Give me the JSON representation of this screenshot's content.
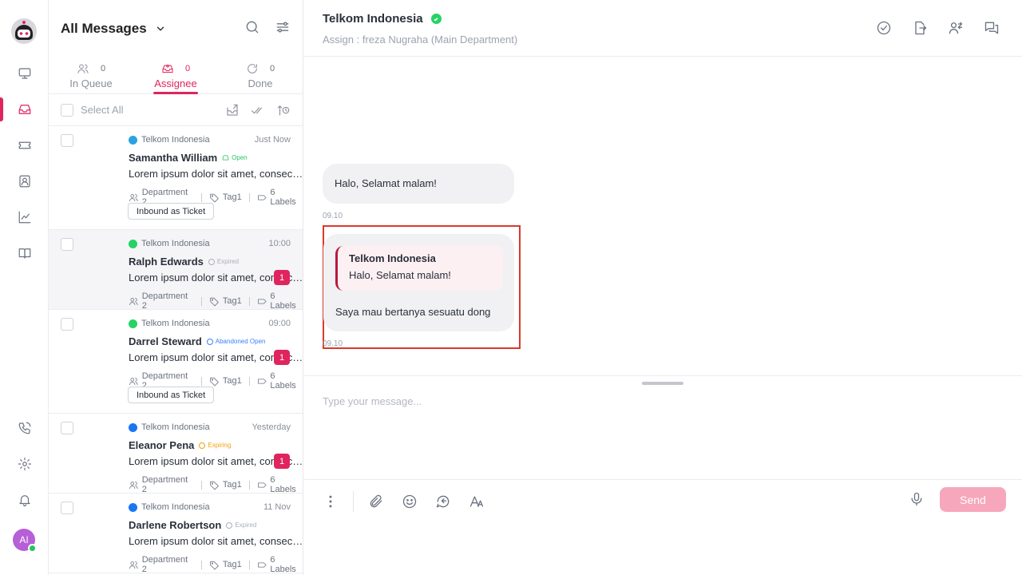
{
  "sidebar": {
    "logo": "robot-logo",
    "nav_items": [
      {
        "name": "dashboard",
        "icon": "monitor-icon"
      },
      {
        "name": "inbox",
        "icon": "inbox-icon",
        "active": true
      },
      {
        "name": "tickets",
        "icon": "ticket-icon"
      },
      {
        "name": "contacts",
        "icon": "contact-icon"
      },
      {
        "name": "reports",
        "icon": "chart-icon"
      },
      {
        "name": "knowledge",
        "icon": "book-icon"
      }
    ],
    "bottom_items": [
      {
        "name": "calls",
        "icon": "phone-icon"
      },
      {
        "name": "settings",
        "icon": "gear-icon"
      },
      {
        "name": "notifications",
        "icon": "bell-icon"
      }
    ],
    "avatar_initials": "AI",
    "accent_color": "#e0245e"
  },
  "inbox": {
    "title": "All Messages",
    "tabs": [
      {
        "label": "In Queue",
        "count": "0"
      },
      {
        "label": "Assignee",
        "count": "0",
        "active": true
      },
      {
        "label": "Done",
        "count": "0"
      }
    ],
    "select_all": "Select All",
    "conversations": [
      {
        "channel": "Telkom Indonesia",
        "channel_type": "telegram",
        "time": "Just Now",
        "name": "Samantha William",
        "status": "Open",
        "preview": "Lorem ipsum dolor sit amet, consectetur",
        "department": "Department 2",
        "tag": "Tag1",
        "labels": "6 Labels",
        "ticket": "Inbound as Ticket",
        "unread": ""
      },
      {
        "channel": "Telkom Indonesia",
        "channel_type": "whatsapp",
        "time": "10:00",
        "name": "Ralph Edwards",
        "status": "Expired",
        "preview": "Lorem ipsum dolor sit amet, consectetur",
        "department": "Department 2",
        "tag": "Tag1",
        "labels": "6 Labels",
        "ticket": "",
        "unread": "1"
      },
      {
        "channel": "Telkom Indonesia",
        "channel_type": "whatsapp",
        "time": "09:00",
        "name": "Darrel Steward",
        "status": "Abandoned Open",
        "preview": "Lorem ipsum dolor sit amet, consectetur",
        "department": "Department 2",
        "tag": "Tag1",
        "labels": "6 Labels",
        "ticket": "Inbound as Ticket",
        "unread": "1"
      },
      {
        "channel": "Telkom Indonesia",
        "channel_type": "facebook",
        "time": "Yesterday",
        "name": "Eleanor Pena",
        "status": "Expiring",
        "preview": "Lorem ipsum dolor sit amet, consectetur",
        "department": "Department 2",
        "tag": "Tag1",
        "labels": "6 Labels",
        "ticket": "",
        "unread": "1"
      },
      {
        "channel": "Telkom Indonesia",
        "channel_type": "facebook",
        "time": "11 Nov",
        "name": "Darlene Robertson",
        "status": "Expired",
        "preview": "Lorem ipsum dolor sit amet, consectetur",
        "department": "Department 2",
        "tag": "Tag1",
        "labels": "6 Labels",
        "ticket": "",
        "unread": ""
      }
    ]
  },
  "chat": {
    "title": "Telkom Indonesia",
    "assign": "Assign : freza Nugraha (Main Department)",
    "messages": [
      {
        "text": "Halo, Selamat malam!",
        "time": "09.10"
      },
      {
        "quote_name": "Telkom Indonesia",
        "quote_text": "Halo, Selamat malam!",
        "text": "Saya mau bertanya sesuatu dong",
        "time": "09.10"
      }
    ],
    "input_placeholder": "Type your message...",
    "send_label": "Send"
  }
}
